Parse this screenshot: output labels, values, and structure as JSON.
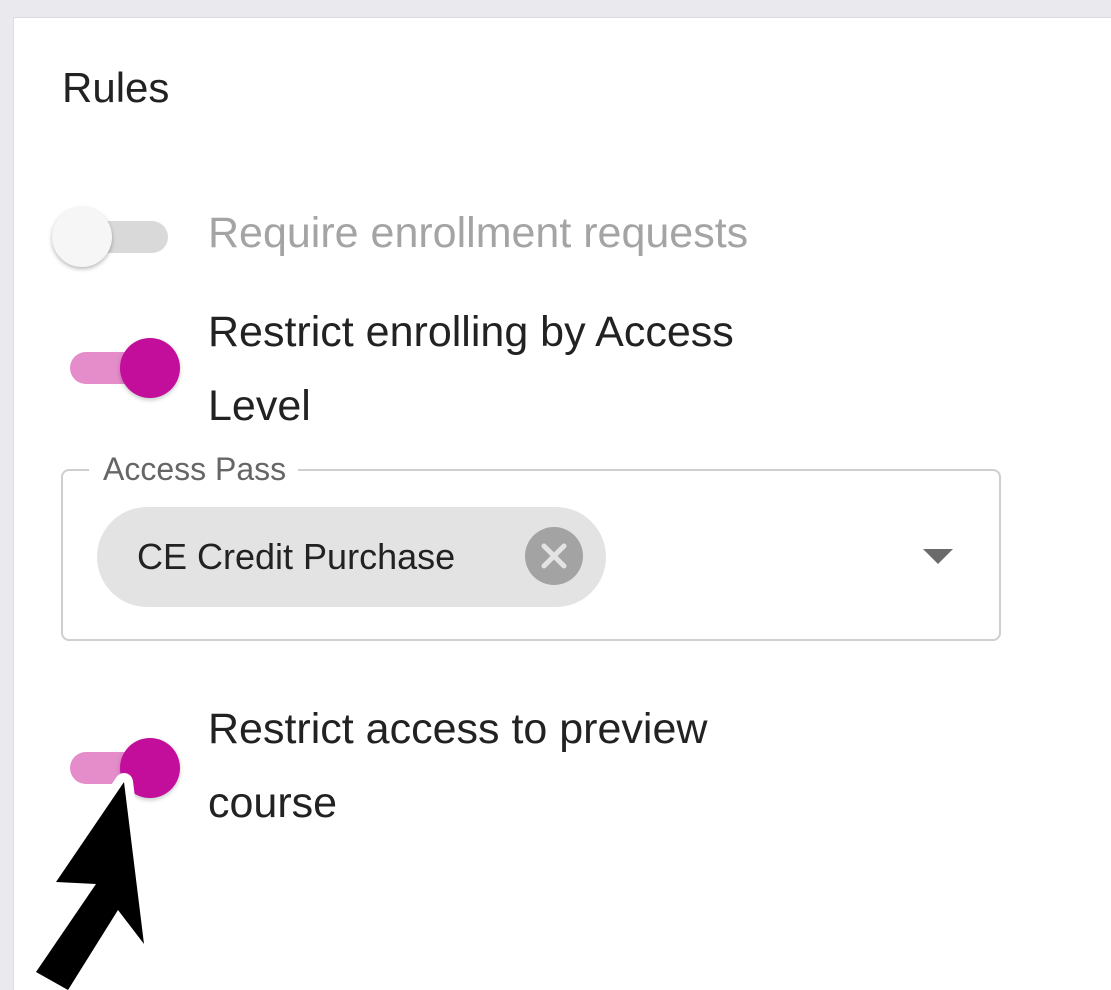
{
  "panel": {
    "title": "Rules"
  },
  "rules": {
    "require_enrollment": {
      "label": "Require enrollment requests",
      "enabled": false,
      "disabled": true
    },
    "restrict_access_level": {
      "label_line1": "Restrict enrolling by Access",
      "label_line2": "Level",
      "enabled": true
    },
    "restrict_preview": {
      "label_line1": "Restrict access to preview",
      "label_line2": "course",
      "enabled": true
    }
  },
  "access_pass": {
    "legend": "Access Pass",
    "selected_chips": [
      {
        "label": "CE Credit Purchase"
      }
    ]
  },
  "icons": {
    "chip_delete": "cancel-circle-icon",
    "dropdown": "arrow-drop-down-icon",
    "cursor": "mouse-pointer-icon"
  },
  "colors": {
    "accent": "#c20e9a",
    "accent_track": "#e58ccb",
    "off_track": "#d9d9d9",
    "disabled_text": "#a4a4a4"
  }
}
